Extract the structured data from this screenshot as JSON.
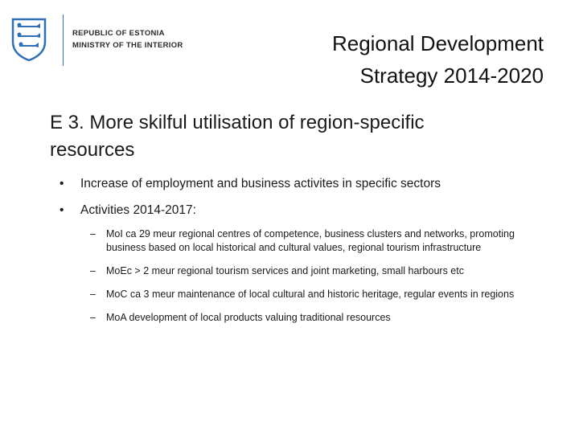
{
  "logo": {
    "line1": "Republic of Estonia",
    "line2": "Ministry of the Interior",
    "accent_color": "#2f6fb8",
    "crest_icon": "three-lions-crest-icon"
  },
  "title": {
    "line1": "Regional Development",
    "line2": "Strategy 2014-2020"
  },
  "heading": {
    "line1": "E 3. More skilful utilisation of region-specific",
    "line2": "resources"
  },
  "bullets": [
    {
      "marker": "•",
      "text": "Increase  of employment and business activites in specific sectors"
    },
    {
      "marker": "•",
      "text": "Activities 2014-2017:"
    }
  ],
  "subbullets": [
    {
      "marker": "–",
      "text": "MoI ca 29 meur regional centres of competence, business clusters and networks, promoting business based on local historical and cultural values, regional tourism infrastructure"
    },
    {
      "marker": "–",
      "text": "MoEc > 2 meur regional tourism services and joint marketing, small harbours etc"
    },
    {
      "marker": "–",
      "text": "MoC ca 3 meur maintenance of local cultural and historic heritage, regular events in regions"
    },
    {
      "marker": "–",
      "text": "MoA development of local products valuing traditional resources"
    }
  ]
}
